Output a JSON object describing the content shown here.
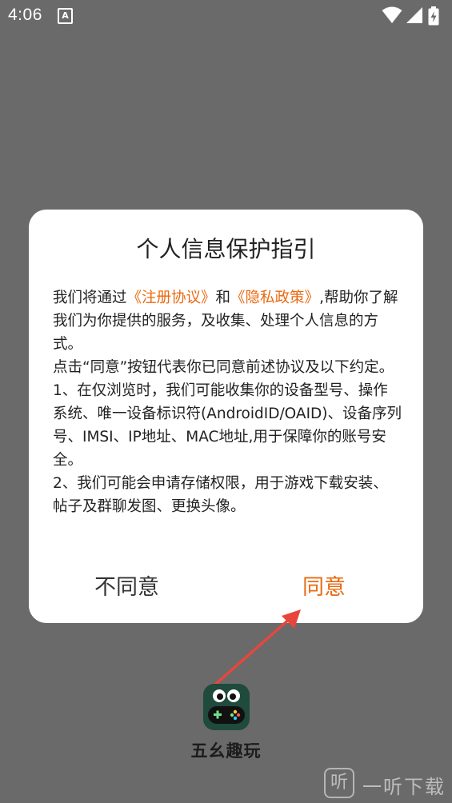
{
  "status_bar": {
    "time": "4:06",
    "notification_badge": "A",
    "icons": [
      "wifi-icon",
      "cell-signal-icon",
      "battery-charging-icon"
    ]
  },
  "dialog": {
    "title": "个人信息保护指引",
    "body": {
      "line1_prefix": "我们将通过",
      "link_register": "《注册协议》",
      "line1_and": "和",
      "link_privacy": "《隐私政策》",
      "line1_suffix": ",帮助你了解我们为你提供的服务，及收集、处理个人信息的方式。",
      "para2": "点击“同意”按钮代表你已同意前述协议及以下约定。",
      "para3": "1、在仅浏览时，我们可能收集你的设备型号、操作系统、唯一设备标识符(AndroidID/OAID)、设备序列号、IMSI、IP地址、MAC地址,用于保障你的账号安全。",
      "para4": "2、我们可能会申请存储权限，用于游戏下载安装、帖子及群聊发图、更换头像。"
    },
    "disagree_label": "不同意",
    "agree_label": "同意"
  },
  "app": {
    "name": "五幺趣玩",
    "icon": "game-controller-face-icon"
  },
  "watermark": {
    "glyph": "听",
    "text": "一听下载"
  },
  "colors": {
    "accent": "#ea6a12",
    "annotation_arrow": "#e8463c",
    "overlay": "#6a6a6a"
  }
}
